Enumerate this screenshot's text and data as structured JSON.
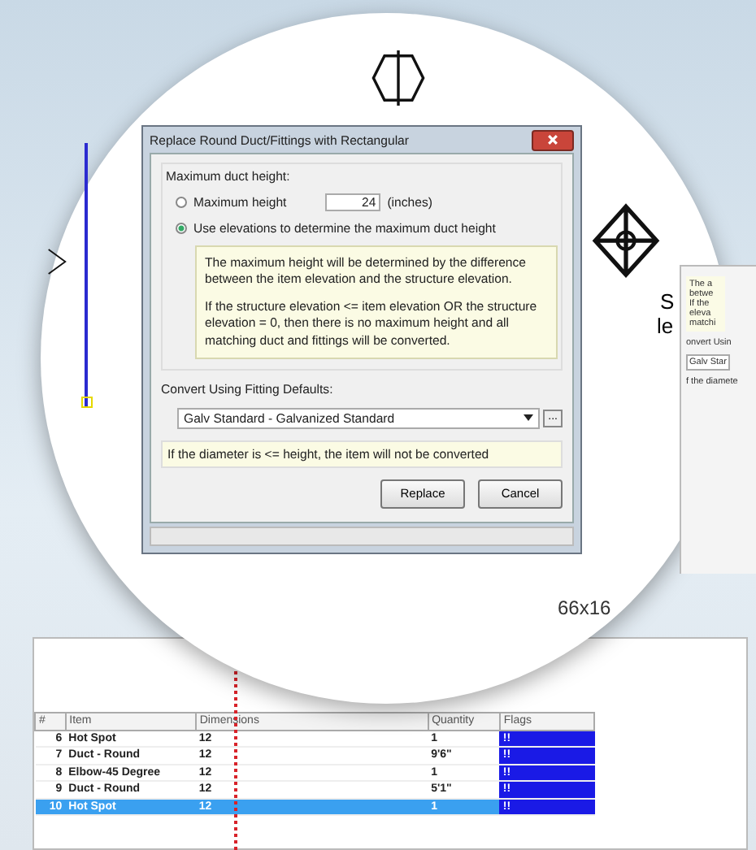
{
  "cad_labels": {
    "dimension": "66x16",
    "side_marks": [
      "S",
      "le"
    ]
  },
  "back_dialog": {
    "lines": [
      "The a",
      "betwe",
      "If the",
      "eleva",
      "matchi"
    ],
    "convert_label": "onvert Usin",
    "dropdown": "Galv Star",
    "note": "f the diamete"
  },
  "dialog": {
    "title": "Replace Round Duct/Fittings with Rectangular",
    "section_label": "Maximum duct height:",
    "options": [
      {
        "kind": "number",
        "label": "Maximum height",
        "selected": false,
        "value": "24",
        "unit": "(inches)"
      },
      {
        "kind": "plain",
        "label": "Use elevations to determine the maximum duct height",
        "selected": true
      }
    ],
    "info": [
      "The maximum height will be determined by the difference between the item elevation and the structure elevation.",
      "If the structure elevation <= item elevation OR the structure elevation = 0, then there is no maximum height and all matching duct and fittings will be converted."
    ],
    "convert_label": "Convert Using Fitting Defaults:",
    "dropdown": "Galv Standard - Galvanized Standard",
    "browse": "...",
    "note": "If the diameter is <= height, the item will not be converted",
    "buttons": [
      "Replace",
      "Cancel"
    ]
  },
  "table": {
    "columns": [
      "#",
      "Item",
      "Dimensions",
      "Quantity",
      "Flags"
    ],
    "rows": [
      {
        "num": "6",
        "item": "Hot Spot",
        "dimensions": "12",
        "quantity": "1",
        "flags": "!!",
        "selected": false
      },
      {
        "num": "7",
        "item": "Duct - Round",
        "dimensions": "12",
        "quantity": "9'6\"",
        "flags": "!!",
        "selected": false
      },
      {
        "num": "8",
        "item": "Elbow-45 Degree",
        "dimensions": "12",
        "quantity": "1",
        "flags": "!!",
        "selected": false
      },
      {
        "num": "9",
        "item": "Duct - Round",
        "dimensions": "12",
        "quantity": "5'1\"",
        "flags": "!!",
        "selected": false
      },
      {
        "num": "10",
        "item": "Hot Spot",
        "dimensions": "12",
        "quantity": "1",
        "flags": "!!",
        "selected": true
      }
    ]
  }
}
